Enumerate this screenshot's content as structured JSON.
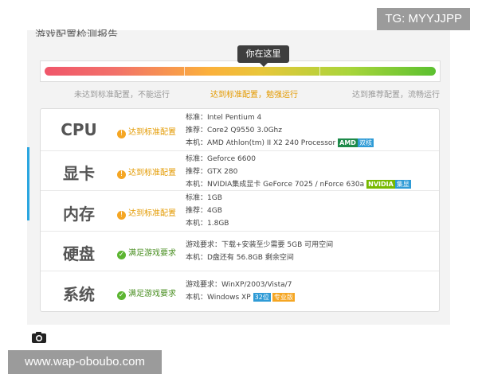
{
  "header": {
    "title": "游戏配置检测报告"
  },
  "overlay": {
    "tg": "TG: MYYJJPP",
    "watermark": "www.wap-oboubo.com"
  },
  "meter": {
    "marker_label": "你在这里",
    "scale": [
      "未达到标准配置，不能运行",
      "达到标准配置，勉强运行",
      "达到推荐配置，流畅运行"
    ]
  },
  "rows": [
    {
      "name": "CPU",
      "status": "达到标准配置",
      "lines": [
        "标准：Intel Pentium 4",
        "推荐：Core2 Q9550 3.0Ghz",
        "本机：AMD Athlon(tm) II X2 240 Processor"
      ],
      "badges": [
        "AMD",
        "双核"
      ]
    },
    {
      "name": "显卡",
      "status": "达到标准配置",
      "lines": [
        "标准：Geforce 6600",
        "推荐：GTX 280",
        "本机：NVIDIA集成显卡 GeForce 7025 / nForce 630a"
      ],
      "badges": [
        "NVIDIA",
        "集显"
      ]
    },
    {
      "name": "内存",
      "status": "达到标准配置",
      "lines": [
        "标准：1GB",
        "推荐：4GB",
        "本机：1.8GB"
      ]
    },
    {
      "name": "硬盘",
      "status": "满足游戏要求",
      "lines": [
        "游戏要求：下载+安装至少需要 5GB 可用空间",
        "本机：D盘还有 56.8GB 剩余空间"
      ]
    },
    {
      "name": "系统",
      "status": "满足游戏要求",
      "lines": [
        "游戏要求：WinXP/2003/Vista/7",
        "本机：Windows XP"
      ],
      "badges": [
        "32位",
        "专业版"
      ]
    }
  ]
}
